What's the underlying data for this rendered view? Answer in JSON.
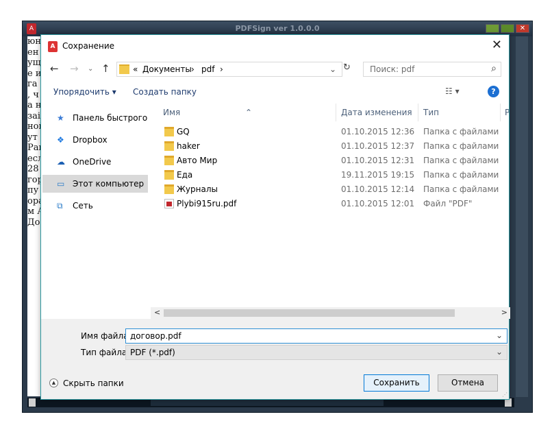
{
  "outer_window": {
    "title": "PDFSign ver 1.0.0.0",
    "doc_fragments": [
      "юн",
      "ен",
      "ущ",
      "е и",
      " га",
      ", ч",
      "а н",
      "заі",
      "ной",
      "ут г",
      "Рак",
      "есл",
      "28",
      "гор",
      " пу",
      "ора",
      "м А",
      " До"
    ]
  },
  "dialog": {
    "title": "Сохранение",
    "breadcrumb": {
      "prefix": "«",
      "items": [
        "Документы",
        "pdf"
      ]
    },
    "search_placeholder": "Поиск: pdf",
    "toolbar": {
      "organize": "Упорядочить ▾",
      "new_folder": "Создать папку",
      "view": "☷ ▾",
      "help": "?"
    },
    "sidebar": [
      {
        "label": "Панель быстрого дс",
        "icon": "star-icon",
        "selected": false
      },
      {
        "label": "Dropbox",
        "icon": "dropbox-icon",
        "selected": false
      },
      {
        "label": "OneDrive",
        "icon": "cloud-icon",
        "selected": false
      },
      {
        "label": "Этот компьютер",
        "icon": "computer-icon",
        "selected": true
      },
      {
        "label": "Сеть",
        "icon": "network-icon",
        "selected": false
      }
    ],
    "columns": {
      "name": "Имя",
      "date": "Дата изменения",
      "type": "Тип",
      "extra": "Р"
    },
    "files": [
      {
        "name": "GQ",
        "date": "01.10.2015 12:36",
        "type": "Папка с файлами",
        "kind": "folder"
      },
      {
        "name": "haker",
        "date": "01.10.2015 12:37",
        "type": "Папка с файлами",
        "kind": "folder"
      },
      {
        "name": "Авто Мир",
        "date": "01.10.2015 12:31",
        "type": "Папка с файлами",
        "kind": "folder"
      },
      {
        "name": "Еда",
        "date": "19.11.2015 19:15",
        "type": "Папка с файлами",
        "kind": "folder"
      },
      {
        "name": "Журналы",
        "date": "01.10.2015 12:14",
        "type": "Папка с файлами",
        "kind": "folder"
      },
      {
        "name": "Plybi915ru.pdf",
        "date": "01.10.2015 12:01",
        "type": "Файл \"PDF\"",
        "kind": "pdf"
      }
    ],
    "filename_label": "Имя файла:",
    "filename_value": "договор.pdf",
    "filetype_label": "Тип файла:",
    "filetype_value": "PDF (*.pdf)",
    "hide_folders": "Скрыть папки",
    "save_button": "Сохранить",
    "cancel_button": "Отмена"
  }
}
